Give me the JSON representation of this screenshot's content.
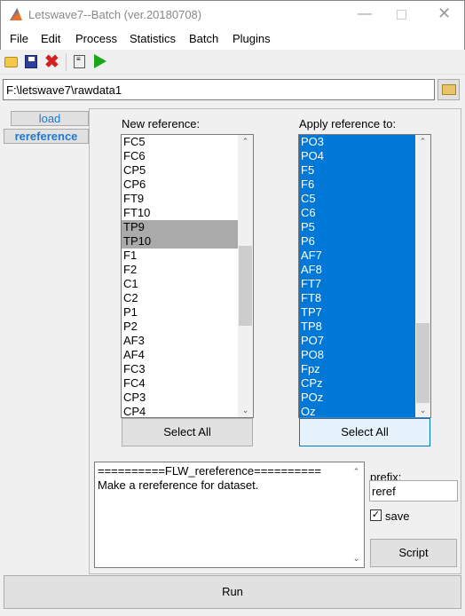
{
  "window": {
    "title": "Letswave7--Batch (ver.20180708)",
    "icon": "matlab-icon"
  },
  "menu": [
    "File",
    "Edit",
    "Process",
    "Statistics",
    "Batch",
    "Plugins"
  ],
  "toolbar": [
    "open-folder-icon",
    "save-icon",
    "delete-icon",
    "script-icon",
    "run-icon"
  ],
  "path": {
    "value": "F:\\letswave7\\rawdata1"
  },
  "steps": [
    {
      "label": "load"
    },
    {
      "label": "rereference"
    }
  ],
  "new_reference": {
    "label": "New reference:",
    "items": [
      "FC5",
      "FC6",
      "CP5",
      "CP6",
      "FT9",
      "FT10",
      "TP9",
      "TP10",
      "F1",
      "F2",
      "C1",
      "C2",
      "P1",
      "P2",
      "AF3",
      "AF4",
      "FC3",
      "FC4",
      "CP3",
      "CP4"
    ],
    "selected": [
      "TP9",
      "TP10"
    ],
    "select_all": "Select All"
  },
  "apply_to": {
    "label": "Apply reference to:",
    "items": [
      "PO3",
      "PO4",
      "F5",
      "F6",
      "C5",
      "C6",
      "P5",
      "P6",
      "AF7",
      "AF8",
      "FT7",
      "FT8",
      "TP7",
      "TP8",
      "PO7",
      "PO8",
      "Fpz",
      "CPz",
      "POz",
      "Oz"
    ],
    "select_all": "Select All"
  },
  "description": {
    "lines": [
      "==========FLW_rereference==========",
      "Make a rereference for dataset."
    ]
  },
  "prefix": {
    "label": "prefix:",
    "value": "reref"
  },
  "save": {
    "label": "save",
    "checked": true
  },
  "script_button": "Script",
  "run_button": "Run",
  "colors": {
    "selection": "#0078d7",
    "tab_text": "#1f77d0"
  }
}
